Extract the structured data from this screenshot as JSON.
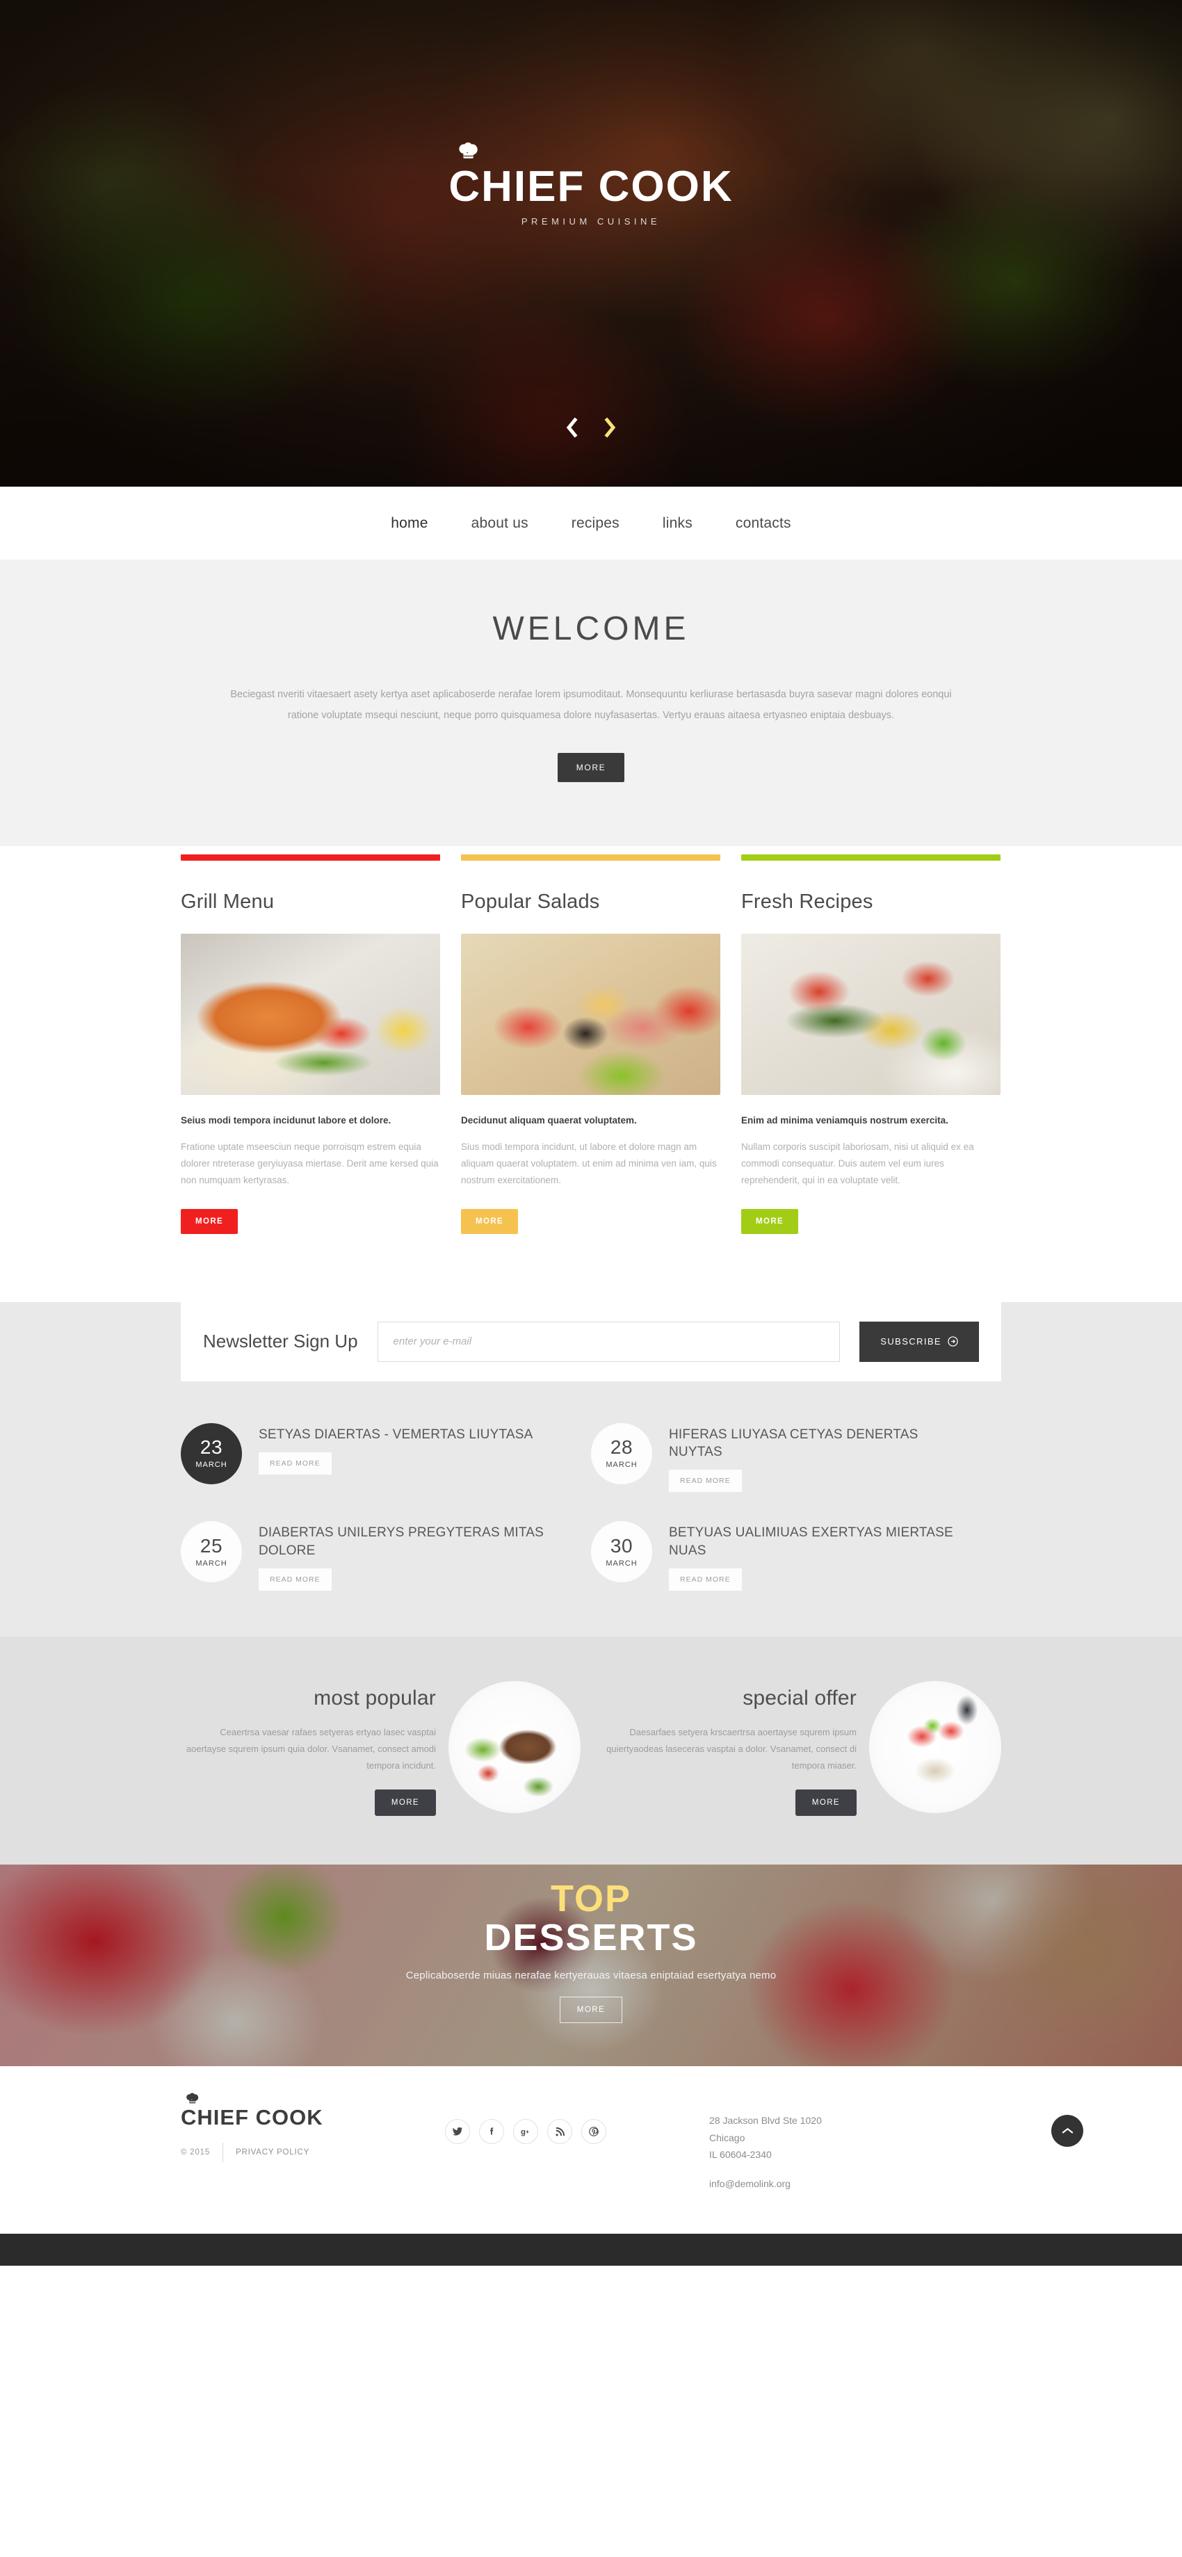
{
  "brand": {
    "name": "CHIEF COOK",
    "tagline": "PREMIUM CUISINE",
    "hat_icon": "chef-hat-icon"
  },
  "hero": {
    "prev_icon": "chevron-left-icon",
    "next_icon": "chevron-right-icon"
  },
  "nav": {
    "items": [
      {
        "label": "home"
      },
      {
        "label": "about us"
      },
      {
        "label": "recipes"
      },
      {
        "label": "links"
      },
      {
        "label": "contacts"
      }
    ]
  },
  "welcome": {
    "title": "WELCOME",
    "paragraph": "Beciegast nveriti vitaesaert asety kertya aset aplicaboserde nerafae lorem ipsumoditaut. Monsequuntu kerliurase bertasasda buyra sasevar magni dolores eonqui ratione voluptate msequi nesciunt, neque porro quisquamesa dolore nuyfasasertas. Vertyu erauas aitaesa ertyasneo eniptaia desbuays.",
    "more_label": "MORE"
  },
  "cards": [
    {
      "title": "Grill Menu",
      "accent": "#F02020",
      "lead": "Seius modi tempora incidunut labore et dolore.",
      "body": "Fratione uptate mseesciun neque porroisqm estrem equia dolorer ntreterase geryiuyasa miertase. Derit ame kersed quia non numquam kertyrasas.",
      "button": "MORE",
      "image_name": "grill-menu-photo"
    },
    {
      "title": "Popular Salads",
      "accent": "#F5C250",
      "lead": "Decidunut  aliquam quaerat voluptatem.",
      "body": "Sius modi tempora incidunt, ut labore et dolore magn am aliquam quaerat voluptatem. ut enim ad minima ven iam, quis nostrum exercitationem.",
      "button": "MORE",
      "image_name": "popular-salads-photo"
    },
    {
      "title": "Fresh Recipes",
      "accent": "#A2CD17",
      "lead": "Enim ad minima veniamquis nostrum exercita.",
      "body": "Nullam corporis suscipit laboriosam, nisi ut aliquid ex ea commodi consequatur. Duis autem vel eum iures reprehenderit, qui in ea voluptate velit.",
      "button": "MORE",
      "image_name": "fresh-recipes-photo"
    }
  ],
  "newsletter": {
    "title": "Newsletter Sign Up",
    "placeholder": "enter your e-mail",
    "value": "",
    "button": "SUBSCRIBE",
    "button_icon": "arrow-circle-right-icon"
  },
  "news": [
    {
      "day": "23",
      "month": "MARCH",
      "title": "SETYAS DIAERTAS - VEMERTAS LIUYTASA",
      "more": "READ MORE",
      "circle": "dark"
    },
    {
      "day": "28",
      "month": "MARCH",
      "title": "HIFERAS LIUYASA CETYAS DENERTAS NUYTAS",
      "more": "READ MORE",
      "circle": "light"
    },
    {
      "day": "25",
      "month": "MARCH",
      "title": "DIABERTAS UNILERYS PREGYTERAS MITAS DOLORE",
      "more": "READ MORE",
      "circle": "light"
    },
    {
      "day": "30",
      "month": "MARCH",
      "title": "BETYUAS UALIMIUAS EXERTYAS MIERTASE NUAS",
      "more": "READ MORE",
      "circle": "light"
    }
  ],
  "promo": [
    {
      "title": "most popular",
      "body": "Ceaertrsa vaesar rafaes setyeras ertyao lasec vasptai aoertayse squrem ipsum quia dolor. Vsanamet, consect amodi tempora incidunt.",
      "button": "MORE",
      "image_name": "most-popular-dish-photo"
    },
    {
      "title": "special offer",
      "body": "Daesarfaes setyera krscaertrsa aoertayse squrem ipsum quiertyaodeas laseceras vasptai a dolor. Vsanamet, consect di tempora miaser.",
      "button": "MORE",
      "image_name": "special-offer-dish-photo"
    }
  ],
  "dessert": {
    "line1": "TOP",
    "line2": "DESSERTS",
    "subtitle": "Ceplicaboserde miuas nerafae kertyerauas vitaesa eniptaiad esertyatya nemo",
    "button": "MORE",
    "accent": "#FBE07A"
  },
  "footer": {
    "logo": "CHIEF COOK",
    "copyright": "© 2015",
    "privacy": "PRIVACY POLICY",
    "social": [
      {
        "name": "twitter-icon",
        "glyph": "t"
      },
      {
        "name": "facebook-icon",
        "glyph": "f"
      },
      {
        "name": "google-plus-icon",
        "glyph": "g+"
      },
      {
        "name": "rss-icon",
        "glyph": "r"
      },
      {
        "name": "pinterest-icon",
        "glyph": "p"
      }
    ],
    "address_line1": "28 Jackson Blvd Ste 1020",
    "address_line2": "Chicago",
    "address_line3": "IL 60604-2340",
    "email": "info@demolink.org",
    "to_top_icon": "chevron-up-icon"
  }
}
